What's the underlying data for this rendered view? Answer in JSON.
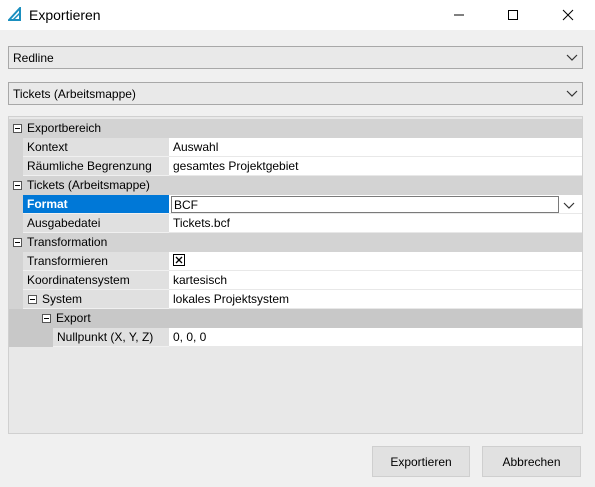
{
  "window": {
    "title": "Exportieren",
    "accent_color": "#0078d7"
  },
  "dropdowns": {
    "first": "Redline",
    "second": "Tickets (Arbeitsmappe)"
  },
  "grid": {
    "cat_export_area": "Exportbereich",
    "context_label": "Kontext",
    "context_value": "Auswahl",
    "spatial_label": "Räumliche Begrenzung",
    "spatial_value": "gesamtes Projektgebiet",
    "cat_tickets": "Tickets (Arbeitsmappe)",
    "format_label": "Format",
    "format_value": "BCF",
    "output_label": "Ausgabedatei",
    "output_value": "Tickets.bcf",
    "cat_transformation": "Transformation",
    "transform_label": "Transformieren",
    "transform_checked": true,
    "coord_label": "Koordinatensystem",
    "coord_value": "kartesisch",
    "system_label": "System",
    "system_value": "lokales Projektsystem",
    "export_sub_label": "Export",
    "origin_label": "Nullpunkt (X, Y, Z)",
    "origin_value": "0, 0, 0"
  },
  "buttons": {
    "export": "Exportieren",
    "cancel": "Abbrechen"
  }
}
